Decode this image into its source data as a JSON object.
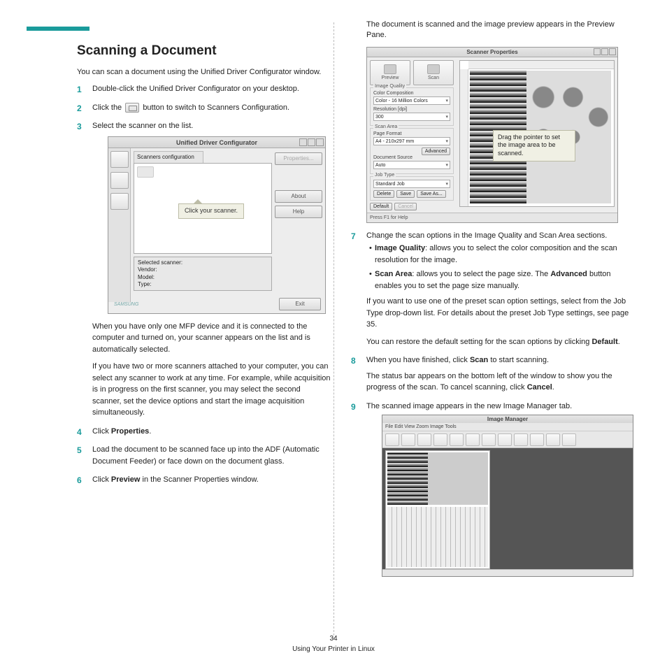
{
  "heading": "Scanning a Document",
  "intro": "You can scan a document using the Unified Driver Configurator window.",
  "steps_left": {
    "s1": "Double-click the Unified Driver Configurator on your desktop.",
    "s2a": "Click the ",
    "s2b": " button to switch to Scanners Configuration.",
    "s3": "Select the scanner on the list.",
    "after_fig_p1": "When you have only one MFP device and it is connected to the computer and turned on, your scanner appears on the list and is automatically selected.",
    "after_fig_p2": "If you have two or more scanners attached to your computer, you can select any scanner to work at any time. For example, while acquisition is in progress on the first scanner, you may select the second scanner, set the device options and start the image acquisition simultaneously.",
    "s4_a": "Click ",
    "s4_b": "Properties",
    "s4_c": ".",
    "s5": "Load the document to be scanned face up into the ADF (Automatic Document Feeder) or face down on the document glass.",
    "s6_a": "Click ",
    "s6_b": "Preview",
    "s6_c": " in the Scanner Properties window."
  },
  "fig1": {
    "title": "Unified Driver Configurator",
    "tab": "Scanners configuration",
    "btn_prop": "Properties...",
    "btn_about": "About",
    "btn_help": "Help",
    "info_hdr": "Selected scanner:",
    "info_vendor": "Vendor:",
    "info_model": "Model:",
    "info_type": "Type:",
    "btn_exit": "Exit",
    "callout": "Click your scanner."
  },
  "right": {
    "p0": "The document is scanned and the image preview appears in the Preview Pane.",
    "s7": "Change the scan options in the Image Quality and Scan Area sections.",
    "b1_a": "Image Quality",
    "b1_b": ": allows you to select the color composition and the scan resolution for the image.",
    "b2_a": "Scan Area",
    "b2_b": ": allows you to select the page size. The ",
    "b2_c": "Advanced",
    "b2_d": " button enables you to set the page size manually.",
    "p7a": "If you want to use one of the preset scan option settings, select from the Job Type drop-down list. For details about the preset Job Type settings, see page 35.",
    "p7b_a": "You can restore the default setting for the scan options by clicking ",
    "p7b_b": "Default",
    "p7b_c": ".",
    "s8_a": "When you have finished, click ",
    "s8_b": "Scan",
    "s8_c": " to start scanning.",
    "p8_a": "The status bar appears on the bottom left of the window to show you the progress of the scan. To cancel scanning, click ",
    "p8_b": "Cancel",
    "p8_c": ".",
    "s9": "The scanned image appears in the new Image Manager tab."
  },
  "fig2": {
    "title": "Scanner Properties",
    "preview": "Preview",
    "scan": "Scan",
    "g_quality": "Image Quality",
    "lbl_color": "Color Composition",
    "val_color": "Color - 16 Million Colors",
    "lbl_res": "Resolution [dpi]",
    "val_res": "300",
    "g_area": "Scan Area",
    "lbl_page": "Page Format",
    "val_page": "A4 - 210x297 mm",
    "btn_adv": "Advanced",
    "lbl_src": "Document Source",
    "val_src": "Auto",
    "g_job": "Job Type",
    "val_job": "Standard Job",
    "btn_del": "Delete",
    "btn_save": "Save",
    "btn_saveas": "Save As...",
    "btn_default": "Default",
    "btn_cancel": "Cancel",
    "status": "Press F1 for Help",
    "callout": "Drag the pointer to set the image area to be scanned."
  },
  "fig3": {
    "title": "Image Manager",
    "menu": "File   Edit   View   Zoom   Image   Tools"
  },
  "footer": {
    "page": "34",
    "section": "Using Your Printer in Linux"
  }
}
